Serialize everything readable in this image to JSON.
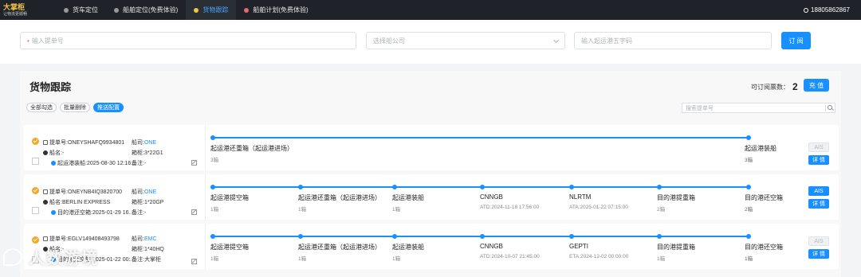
{
  "app": {
    "logo_title": "大掌柜",
    "logo_subtitle": "让物流更顺畅"
  },
  "nav": {
    "items": [
      {
        "label": "货车定位"
      },
      {
        "label": "船舶定位(免费体验)"
      },
      {
        "label": "货物跟踪"
      },
      {
        "label": "船舶计划(免费体验)"
      }
    ],
    "user_phone": "18805862867"
  },
  "search": {
    "bl_placeholder": "输入提单号",
    "carrier_placeholder": "选择船公司",
    "port_placeholder": "输入起运港五字码",
    "subscribe_label": "订 阅"
  },
  "main": {
    "title": "货物跟踪",
    "quota_label": "可订阅票数：",
    "quota_value": "2",
    "recharge_label": "充 值",
    "select_all": "全部勾选",
    "batch_delete": "批量删除",
    "push_config": "推送配置",
    "search_placeholder": "搜索提单号"
  },
  "rows": [
    {
      "bl": "提单号:ONEYSHAFQ9934801",
      "vessel": "船名:-",
      "event": "起运港装船:2025-08-30 12:16...",
      "carrier_prefix": "船司:",
      "carrier": "ONE",
      "container": "箱柜:3*22G1",
      "remark": "备注:-",
      "stages": [
        {
          "label": "起运港还重箱（起运港进场）",
          "sub": "3箱"
        }
      ],
      "final": {
        "label": "起运港装船",
        "sub": "3箱"
      },
      "ais": "AIS",
      "ais_enabled": false,
      "detail": "详 情"
    },
    {
      "bl": "提单号:ONEYNB4IQ3820700",
      "vessel": "船名:BERLIN EXPRESS",
      "event": "目的港还空箱:2025-01-29 16...",
      "carrier_prefix": "船司:",
      "carrier": "ONE",
      "container": "箱柜:1*20GP",
      "remark": "备注:-",
      "stages": [
        {
          "label": "起运港提空箱",
          "sub": "1箱"
        },
        {
          "label": "起运港还重箱（起运港进场）",
          "sub": "1箱"
        },
        {
          "label": "起运港装船",
          "sub": "1箱"
        },
        {
          "label": "CNNGB",
          "sub": "ATD:2024-11-18 17:56:00"
        },
        {
          "label": "NLRTM",
          "sub": "ATA:2025-01-22 07:15:00"
        },
        {
          "label": "目的港提重箱",
          "sub": "2箱"
        }
      ],
      "final": {
        "label": "目的港还空箱",
        "sub": "2箱"
      },
      "ais": "AIS",
      "ais_enabled": true,
      "detail": "详 情"
    },
    {
      "bl": "提单号:EGLV149408493798",
      "vessel": "船名:-",
      "event": "目的港还空箱:2025-01-22 00:...",
      "carrier_prefix": "船司:",
      "carrier": "EMC",
      "container": "箱柜:1*40HQ",
      "remark": "备注:大掌柜",
      "stages": [
        {
          "label": "起运港提空箱",
          "sub": "1箱"
        },
        {
          "label": "起运港还重箱（起运港进场）",
          "sub": "1箱"
        },
        {
          "label": "起运港装船",
          "sub": "1箱"
        },
        {
          "label": "CNNGB",
          "sub": "ATD:2024-10-07 21:45:00"
        },
        {
          "label": "GEPTI",
          "sub": "ETA:2024-12-02 00:00:00"
        },
        {
          "label": "目的港提重箱",
          "sub": "1箱"
        }
      ],
      "final": {
        "label": "目的港还空箱",
        "sub": "1箱"
      },
      "ais": "AIS",
      "ais_enabled": false,
      "detail": "详 情"
    }
  ],
  "watermark": "人数游境",
  "colors": {
    "accent": "#1890ff",
    "nav_bg": "#1f2329",
    "warning": "#f5a623"
  }
}
